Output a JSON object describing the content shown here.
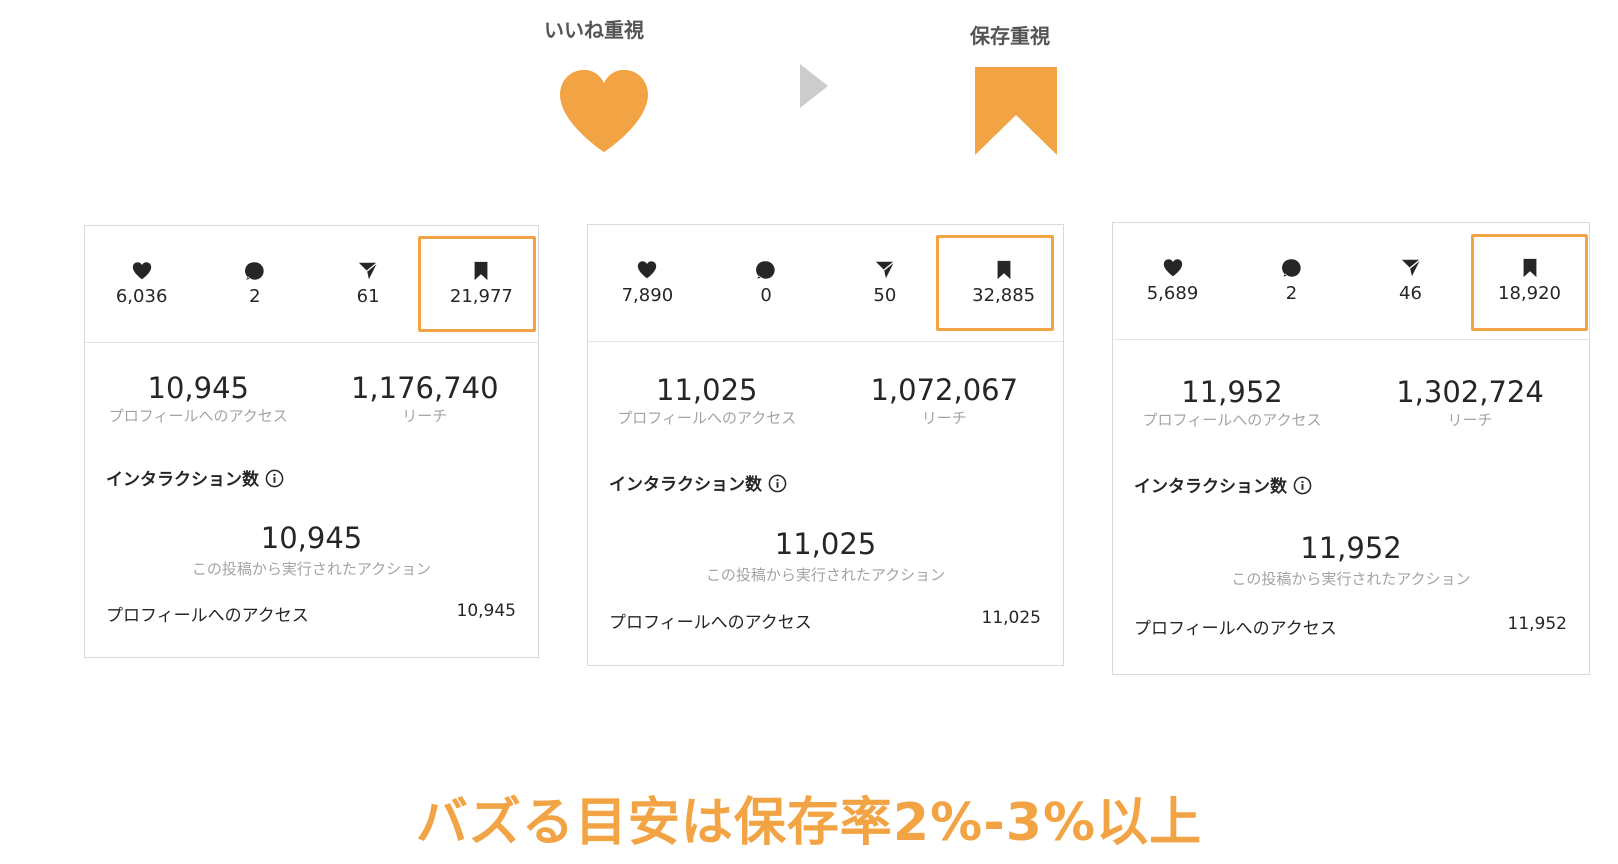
{
  "header": {
    "likes_label": "いいね重視",
    "saves_label": "保存重視",
    "accent_color": "#f2a444",
    "arrow_color": "#cccccc"
  },
  "icons": {
    "heart": "heart-icon",
    "arrow": "play-arrow-icon",
    "bookmark": "bookmark-icon"
  },
  "cards": [
    {
      "likes": "6,036",
      "comments": "2",
      "shares": "61",
      "saves": "21,977",
      "profile_visits_value": "10,945",
      "profile_visits_label": "プロフィールへのアクセス",
      "reach_value": "1,176,740",
      "reach_label": "リーチ",
      "interactions_title": "インタラクション数",
      "interactions_value": "10,945",
      "interactions_label": "この投稿から実行されたアクション",
      "row_label": "プロフィールへのアクセス",
      "row_value": "10,945"
    },
    {
      "likes": "7,890",
      "comments": "0",
      "shares": "50",
      "saves": "32,885",
      "profile_visits_value": "11,025",
      "profile_visits_label": "プロフィールへのアクセス",
      "reach_value": "1,072,067",
      "reach_label": "リーチ",
      "interactions_title": "インタラクション数",
      "interactions_value": "11,025",
      "interactions_label": "この投稿から実行されたアクション",
      "row_label": "プロフィールへのアクセス",
      "row_value": "11,025"
    },
    {
      "likes": "5,689",
      "comments": "2",
      "shares": "46",
      "saves": "18,920",
      "profile_visits_value": "11,952",
      "profile_visits_label": "プロフィールへのアクセス",
      "reach_value": "1,302,724",
      "reach_label": "リーチ",
      "interactions_title": "インタラクション数",
      "interactions_value": "11,952",
      "interactions_label": "この投稿から実行されたアクション",
      "row_label": "プロフィールへのアクセス",
      "row_value": "11,952"
    }
  ],
  "headline": "バズる目安は保存率2%-3%以上"
}
